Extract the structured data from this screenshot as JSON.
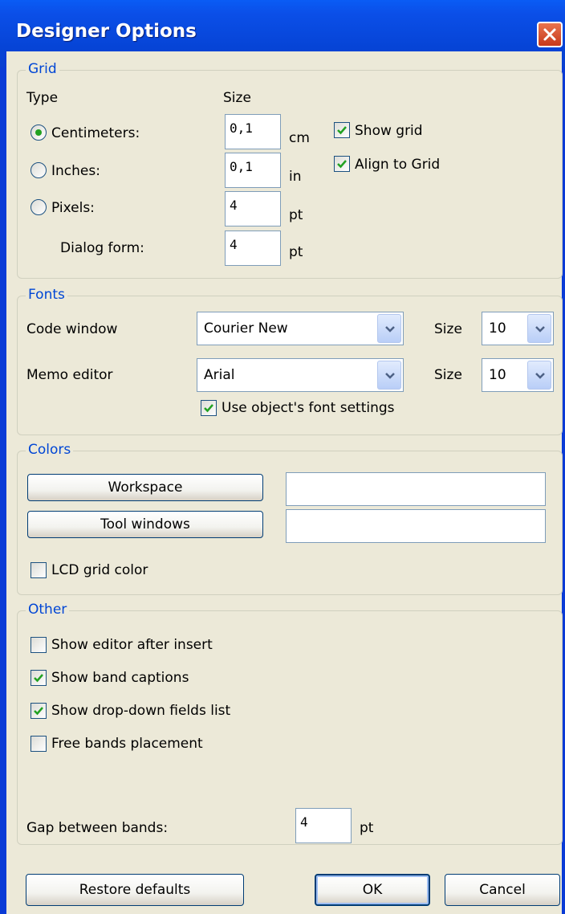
{
  "window": {
    "title": "Designer Options"
  },
  "grid": {
    "legend": "Grid",
    "type_header": "Type",
    "size_header": "Size",
    "rows": [
      {
        "label": "Centimeters:",
        "value": "0,1",
        "unit": "cm",
        "selected": true
      },
      {
        "label": "Inches:",
        "value": "0,1",
        "unit": "in",
        "selected": false
      },
      {
        "label": "Pixels:",
        "value": "4",
        "unit": "pt",
        "selected": false
      }
    ],
    "dialog_form": {
      "label": "Dialog form:",
      "value": "4",
      "unit": "pt"
    },
    "show_grid": {
      "label": "Show grid",
      "checked": true
    },
    "align_to_grid": {
      "label": "Align to Grid",
      "checked": true
    }
  },
  "fonts": {
    "legend": "Fonts",
    "code_window": {
      "label": "Code window",
      "font": "Courier New",
      "size_label": "Size",
      "size": "10"
    },
    "memo_editor": {
      "label": "Memo editor",
      "font": "Arial",
      "size_label": "Size",
      "size": "10"
    },
    "use_object_font": {
      "label": "Use object's font settings",
      "checked": true
    }
  },
  "colors": {
    "legend": "Colors",
    "workspace_button": "Workspace",
    "tool_windows_button": "Tool windows",
    "lcd_grid_color": {
      "label": "LCD grid color",
      "checked": false
    }
  },
  "other": {
    "legend": "Other",
    "options": [
      {
        "label": "Show editor after insert",
        "checked": false
      },
      {
        "label": "Show band captions",
        "checked": true
      },
      {
        "label": "Show drop-down fields list",
        "checked": true
      },
      {
        "label": "Free bands placement",
        "checked": false
      }
    ],
    "gap": {
      "label": "Gap between bands:",
      "value": "4",
      "unit": "pt"
    }
  },
  "footer": {
    "restore_label": "Restore defaults",
    "ok_label": "OK",
    "cancel_label": "Cancel"
  },
  "colors_theme": {
    "legend_color": "#0046d5",
    "title_bar": "#0a4fe8",
    "check_mark": "#21a121"
  }
}
